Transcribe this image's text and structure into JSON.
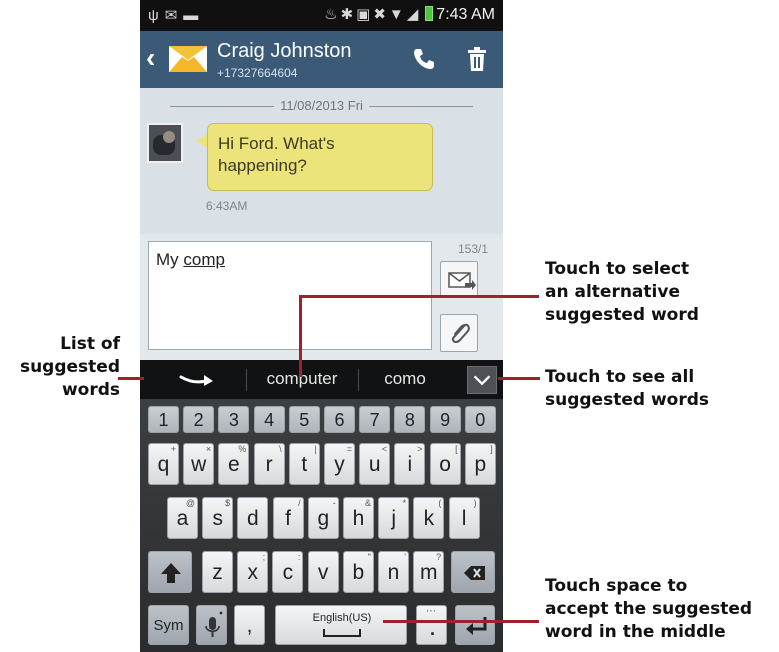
{
  "status_bar": {
    "time": "7:43 AM"
  },
  "header": {
    "contact_name": "Craig Johnston",
    "contact_number": "+17327664604"
  },
  "conversation": {
    "date": "11/08/2013 Fri",
    "message_text": "Hi Ford. What's happening?",
    "message_time": "6:43AM"
  },
  "compose": {
    "typed_text_prefix": "My ",
    "typed_text_word": "comp",
    "char_counter": "153/1"
  },
  "suggestions": {
    "items": [
      "computer",
      "como"
    ]
  },
  "keyboard": {
    "numbers": [
      "1",
      "2",
      "3",
      "4",
      "5",
      "6",
      "7",
      "8",
      "9",
      "0"
    ],
    "row1": [
      "q",
      "w",
      "e",
      "r",
      "t",
      "y",
      "u",
      "i",
      "o",
      "p"
    ],
    "row1_sub": [
      "+",
      "×",
      "%",
      "\\",
      "|",
      "=",
      "<",
      ">",
      "[",
      "]"
    ],
    "row2": [
      "a",
      "s",
      "d",
      "f",
      "g",
      "h",
      "j",
      "k",
      "l"
    ],
    "row2_sub": [
      "@",
      "$",
      "",
      "/",
      "-",
      "&",
      "*",
      "(",
      ")"
    ],
    "row3": [
      "z",
      "x",
      "c",
      "v",
      "b",
      "n",
      "m"
    ],
    "row3_sub": [
      "",
      ";",
      ":",
      "",
      "\"",
      "'",
      "?"
    ],
    "sym_label": "Sym",
    "comma_label": ",",
    "space_label": "English(US)",
    "period_label": "."
  },
  "annotations": {
    "select_alternative": "Touch to select\nan alternative\nsuggested word",
    "list_of_suggested": "List of\nsuggested\nwords",
    "see_all": "Touch to see all\nsuggested words",
    "space_accept": "Touch space to\naccept the suggested\nword in the middle"
  },
  "colors": {
    "header_bg": "#3a5a78",
    "bubble_bg": "#ece47a",
    "leader_line": "#a0212b"
  }
}
